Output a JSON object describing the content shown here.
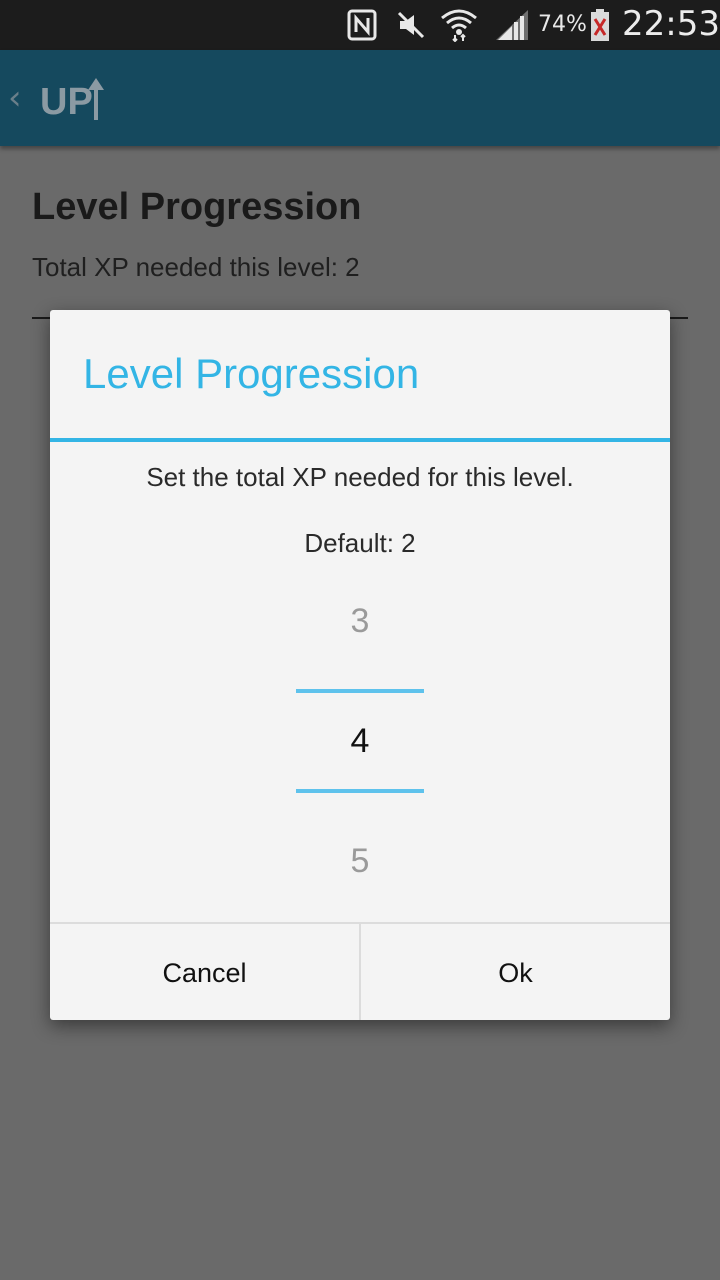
{
  "status_bar": {
    "icons": [
      "nfc-icon",
      "mute-icon",
      "wifi-icon",
      "signal-icon",
      "battery-icon"
    ],
    "battery_percent": "74%",
    "time": "22:53"
  },
  "action_bar": {
    "logo_text": "UP"
  },
  "page": {
    "title": "Level Progression",
    "subtitle": "Total XP needed this level: 2"
  },
  "dialog": {
    "title": "Level Progression",
    "message": "Set the total XP needed for this level.",
    "default_text": "Default: 2",
    "picker": {
      "previous": "3",
      "current": "4",
      "next": "5"
    },
    "buttons": {
      "cancel": "Cancel",
      "ok": "Ok"
    }
  },
  "colors": {
    "accent": "#33b5e5",
    "action_bar": "#15495e",
    "status_bar": "#1c1c1c",
    "dim_background": "#6a6a6a"
  }
}
